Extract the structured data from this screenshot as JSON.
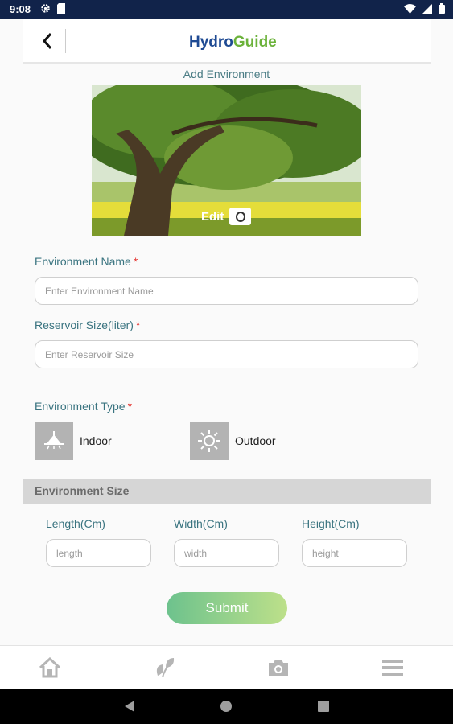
{
  "status_bar": {
    "time": "9:08",
    "icons": [
      "gear-icon",
      "sim-icon",
      "wifi-icon",
      "signal-icon",
      "battery-icon"
    ]
  },
  "header": {
    "logo_part1": "Hydro",
    "logo_part2": "Guide"
  },
  "page_title": "Add Environment",
  "image": {
    "edit_label": "Edit"
  },
  "form": {
    "name_label": "Environment Name",
    "name_placeholder": "Enter Environment Name",
    "reservoir_label": "Reservoir Size(liter)",
    "reservoir_placeholder": "Enter Reservoir Size",
    "required_mark": "*",
    "type_label": "Environment Type",
    "type_options": [
      {
        "label": "Indoor",
        "icon": "lamp-icon"
      },
      {
        "label": "Outdoor",
        "icon": "sun-icon"
      }
    ]
  },
  "size_section": {
    "title": "Environment Size",
    "fields": [
      {
        "label": "Length(Cm)",
        "placeholder": "length"
      },
      {
        "label": "Width(Cm)",
        "placeholder": "width"
      },
      {
        "label": "Height(Cm)",
        "placeholder": "height"
      }
    ]
  },
  "submit_label": "Submit",
  "bottom_nav": [
    "home-icon",
    "plant-icon",
    "camera-icon",
    "menu-icon"
  ],
  "colors": {
    "status_bar": "#11234a",
    "label_teal": "#3a7480",
    "required_red": "#e53935",
    "submit_gradient_start": "#6dc28d",
    "submit_gradient_end": "#bde08a"
  }
}
